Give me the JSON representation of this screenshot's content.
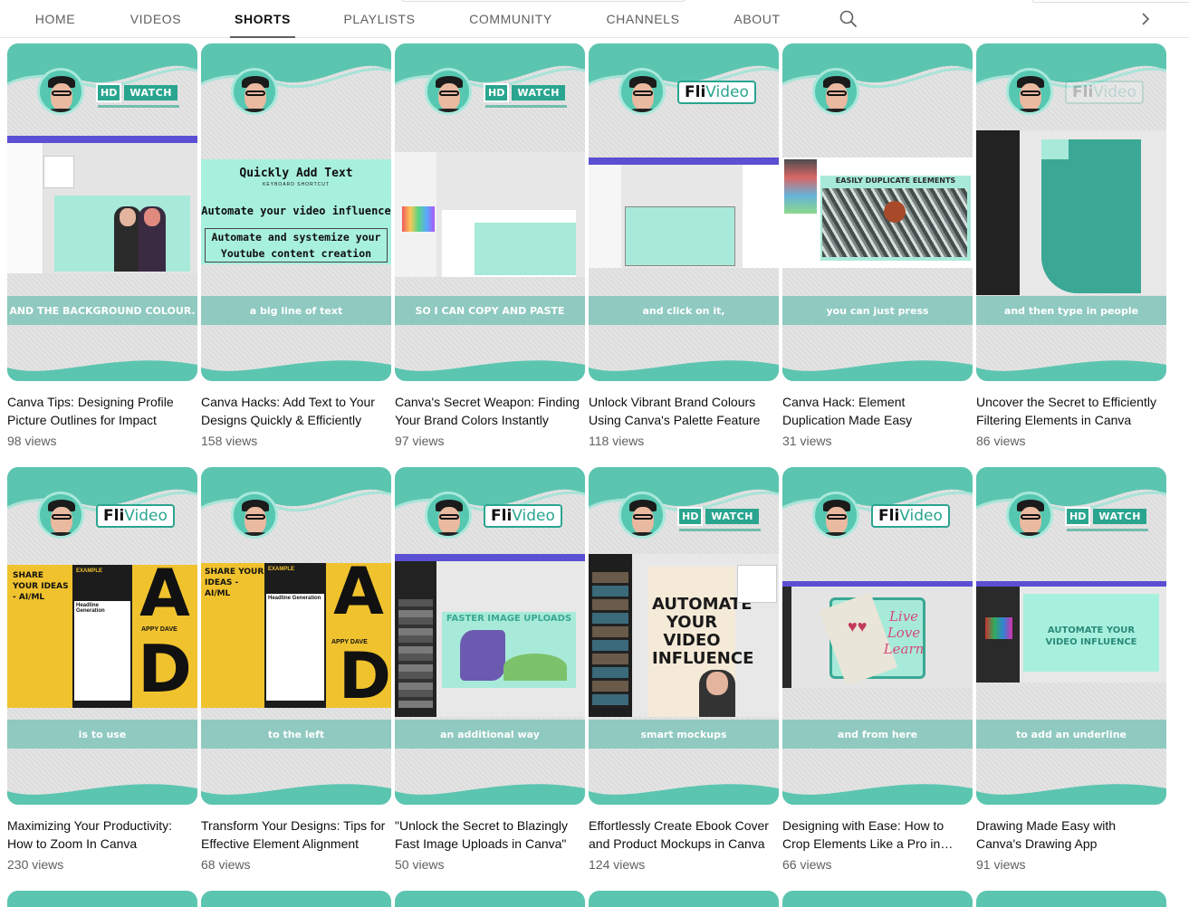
{
  "tabs": [
    {
      "label": "HOME",
      "active": false
    },
    {
      "label": "VIDEOS",
      "active": false
    },
    {
      "label": "SHORTS",
      "active": true
    },
    {
      "label": "PLAYLISTS",
      "active": false
    },
    {
      "label": "COMMUNITY",
      "active": false
    },
    {
      "label": "CHANNELS",
      "active": false
    },
    {
      "label": "ABOUT",
      "active": false
    }
  ],
  "icons": {
    "search": "search-icon",
    "next": "chevron-right-icon"
  },
  "colors": {
    "accent_teal": "#5cc5b0",
    "caption_band": "#8fc9c0",
    "brand_teal": "#2aa58f"
  },
  "logos": {
    "hd": "HD",
    "watch": "WATCH",
    "fli": "Fli",
    "video": "Video"
  },
  "shorts": [
    {
      "title": "Canva Tips: Designing Profile Picture Outlines for Impact",
      "views": "98 views",
      "caption": "AND THE BACKGROUND COLOUR.",
      "logo": "hd"
    },
    {
      "title": "Canva Hacks: Add Text to Your Designs Quickly & Efficiently",
      "views": "158 views",
      "caption": "a big line of text",
      "logo": "none",
      "overlay": {
        "line1": "Quickly Add Text",
        "line1_sub": "KEYBOARD SHORTCUT",
        "line2": "Automate your video influence",
        "line3": "Automate and systemize your Youtube content creation"
      }
    },
    {
      "title": "Canva's Secret Weapon: Finding Your Brand Colors Instantly",
      "views": "97 views",
      "caption": "SO I CAN COPY AND PASTE",
      "logo": "hd"
    },
    {
      "title": "Unlock Vibrant Brand Colours Using Canva's Palette Feature",
      "views": "118 views",
      "caption": "and click on it,",
      "logo": "fli"
    },
    {
      "title": "Canva Hack: Element Duplication Made Easy",
      "views": "31 views",
      "caption": "you can just press",
      "logo": "none",
      "overlay": {
        "line1": "EASILY DUPLICATE ELEMENTS"
      }
    },
    {
      "title": "Uncover the Secret to Efficiently Filtering Elements in Canva",
      "views": "86 views",
      "caption": "and then type in people",
      "logo": "fli-faded"
    },
    {
      "title": "Maximizing Your Productivity: How to Zoom In Canva",
      "views": "230 views",
      "caption": "is to use",
      "logo": "fli",
      "overlay": {
        "line1": "SHARE YOUR IDEAS - AI/ML",
        "line2": "APPY DAVE",
        "line3": "Headline Generation",
        "line4": "EXAMPLE"
      }
    },
    {
      "title": "Transform Your Designs: Tips for Effective Element Alignment",
      "views": "68 views",
      "caption": "to the left",
      "logo": "none",
      "overlay": {
        "line1": "SHARE YOUR IDEAS - AI/ML",
        "line2": "APPY DAVE",
        "line3": "Headline Generation",
        "line4": "EXAMPLE"
      }
    },
    {
      "title": "\"Unlock the Secret to Blazingly Fast Image Uploads in Canva\"",
      "views": "50 views",
      "caption": "an additional way",
      "logo": "fli",
      "overlay": {
        "line1": "FASTER IMAGE UPLOADS"
      }
    },
    {
      "title": "Effortlessly Create Ebook Cover and Product Mockups in Canva",
      "views": "124 views",
      "caption": "smart mockups",
      "logo": "hd",
      "overlay": {
        "line1": "AUTOMATE YOUR VIDEO INFLUENCE"
      }
    },
    {
      "title": "Designing with Ease: How to Crop Elements Like a Pro in Canva",
      "views": "66 views",
      "caption": "and from here",
      "logo": "fli",
      "overlay": {
        "line1": "Live",
        "line2": "Love",
        "line3": "Learn"
      }
    },
    {
      "title": "Drawing Made Easy with Canva's Drawing App",
      "views": "91 views",
      "caption": "to add an underline",
      "logo": "hd",
      "overlay": {
        "line1": "AUTOMATE YOUR VIDEO INFLUENCE"
      }
    }
  ]
}
